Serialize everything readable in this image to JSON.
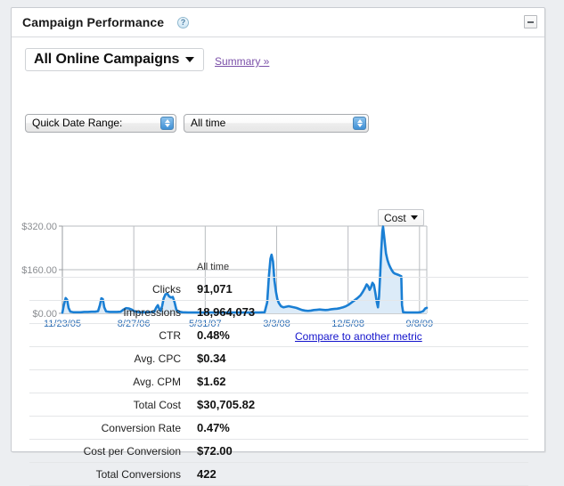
{
  "panel": {
    "title": "Campaign Performance",
    "help_icon": "question-mark-icon",
    "minimize_icon": "minimize-icon"
  },
  "controls": {
    "campaign_selector_label": "All Online Campaigns",
    "summary_link": "Summary »",
    "date_range_label": "Quick Date Range:",
    "time_period_value": "All time"
  },
  "chart_controls": {
    "metric_label": "Cost",
    "compare_link": "Compare to another metric"
  },
  "table": {
    "column_header": "All time",
    "rows": [
      {
        "label": "Clicks",
        "value": "91,071"
      },
      {
        "label": "Impressions",
        "value": "18,964,073"
      },
      {
        "label": "CTR",
        "value": "0.48%"
      },
      {
        "label": "Avg. CPC",
        "value": "$0.34"
      },
      {
        "label": "Avg. CPM",
        "value": "$1.62"
      },
      {
        "label": "Total Cost",
        "value": "$30,705.82"
      },
      {
        "label": "Conversion Rate",
        "value": "0.47%"
      },
      {
        "label": "Cost per Conversion",
        "value": "$72.00"
      },
      {
        "label": "Total Conversions",
        "value": "422"
      }
    ]
  },
  "colors": {
    "line": "#1a7fd4",
    "fill": "#dcebf8",
    "grid": "#b9bcc0",
    "axis_text": "#8a8d91",
    "tick_text": "#2f6fb5",
    "link": "#1414cc",
    "visited_link": "#7a4fa8"
  },
  "chart_data": {
    "type": "area",
    "title": "Cost",
    "xlabel": "",
    "ylabel": "Cost",
    "ylim": [
      0,
      320
    ],
    "yticks": [
      0,
      160,
      320
    ],
    "ytick_labels": [
      "$0.00",
      "$160.00",
      "$320.00"
    ],
    "grid": true,
    "legend": "none",
    "xtick_labels": [
      "11/23/05",
      "8/27/06",
      "5/31/07",
      "3/3/08",
      "12/5/08",
      "9/8/09"
    ],
    "xtick_positions": [
      0.0,
      0.196,
      0.392,
      0.588,
      0.784,
      0.98
    ],
    "x_unit": "date",
    "series": [
      {
        "name": "Cost",
        "points": [
          [
            0.0,
            2
          ],
          [
            0.004,
            30
          ],
          [
            0.009,
            56
          ],
          [
            0.013,
            50
          ],
          [
            0.017,
            20
          ],
          [
            0.022,
            6
          ],
          [
            0.03,
            4
          ],
          [
            0.04,
            4
          ],
          [
            0.05,
            4
          ],
          [
            0.06,
            5
          ],
          [
            0.07,
            5
          ],
          [
            0.08,
            6
          ],
          [
            0.09,
            6
          ],
          [
            0.098,
            8
          ],
          [
            0.103,
            30
          ],
          [
            0.107,
            55
          ],
          [
            0.111,
            52
          ],
          [
            0.115,
            22
          ],
          [
            0.12,
            7
          ],
          [
            0.13,
            5
          ],
          [
            0.14,
            5
          ],
          [
            0.15,
            5
          ],
          [
            0.16,
            6
          ],
          [
            0.168,
            14
          ],
          [
            0.175,
            19
          ],
          [
            0.182,
            18
          ],
          [
            0.19,
            14
          ],
          [
            0.197,
            8
          ],
          [
            0.205,
            5
          ],
          [
            0.215,
            4
          ],
          [
            0.225,
            4
          ],
          [
            0.235,
            4
          ],
          [
            0.245,
            5
          ],
          [
            0.252,
            6
          ],
          [
            0.258,
            22
          ],
          [
            0.262,
            30
          ],
          [
            0.266,
            16
          ],
          [
            0.27,
            9
          ],
          [
            0.274,
            28
          ],
          [
            0.278,
            55
          ],
          [
            0.283,
            70
          ],
          [
            0.288,
            72
          ],
          [
            0.293,
            62
          ],
          [
            0.298,
            58
          ],
          [
            0.303,
            60
          ],
          [
            0.308,
            40
          ],
          [
            0.313,
            12
          ],
          [
            0.32,
            6
          ],
          [
            0.33,
            4
          ],
          [
            0.345,
            3
          ],
          [
            0.36,
            3
          ],
          [
            0.38,
            3
          ],
          [
            0.4,
            3
          ],
          [
            0.42,
            3
          ],
          [
            0.44,
            3
          ],
          [
            0.46,
            3
          ],
          [
            0.48,
            3
          ],
          [
            0.5,
            3
          ],
          [
            0.52,
            3
          ],
          [
            0.54,
            3
          ],
          [
            0.555,
            4
          ],
          [
            0.562,
            40
          ],
          [
            0.567,
            140
          ],
          [
            0.571,
            200
          ],
          [
            0.574,
            215
          ],
          [
            0.578,
            190
          ],
          [
            0.582,
            120
          ],
          [
            0.586,
            80
          ],
          [
            0.59,
            52
          ],
          [
            0.594,
            38
          ],
          [
            0.6,
            26
          ],
          [
            0.607,
            22
          ],
          [
            0.614,
            24
          ],
          [
            0.621,
            26
          ],
          [
            0.628,
            24
          ],
          [
            0.635,
            22
          ],
          [
            0.642,
            20
          ],
          [
            0.65,
            16
          ],
          [
            0.658,
            12
          ],
          [
            0.666,
            10
          ],
          [
            0.674,
            9
          ],
          [
            0.682,
            10
          ],
          [
            0.69,
            12
          ],
          [
            0.698,
            13
          ],
          [
            0.706,
            14
          ],
          [
            0.714,
            13
          ],
          [
            0.722,
            12
          ],
          [
            0.73,
            13
          ],
          [
            0.738,
            15
          ],
          [
            0.746,
            16
          ],
          [
            0.754,
            17
          ],
          [
            0.762,
            19
          ],
          [
            0.77,
            22
          ],
          [
            0.778,
            26
          ],
          [
            0.786,
            32
          ],
          [
            0.794,
            40
          ],
          [
            0.802,
            48
          ],
          [
            0.81,
            56
          ],
          [
            0.818,
            66
          ],
          [
            0.824,
            78
          ],
          [
            0.83,
            92
          ],
          [
            0.835,
            106
          ],
          [
            0.839,
            100
          ],
          [
            0.843,
            86
          ],
          [
            0.847,
            96
          ],
          [
            0.851,
            112
          ],
          [
            0.855,
            104
          ],
          [
            0.859,
            74
          ],
          [
            0.863,
            40
          ],
          [
            0.866,
            22
          ],
          [
            0.869,
            62
          ],
          [
            0.872,
            140
          ],
          [
            0.875,
            230
          ],
          [
            0.878,
            300
          ],
          [
            0.88,
            318
          ],
          [
            0.884,
            270
          ],
          [
            0.888,
            220
          ],
          [
            0.892,
            196
          ],
          [
            0.896,
            180
          ],
          [
            0.9,
            168
          ],
          [
            0.904,
            158
          ],
          [
            0.908,
            150
          ],
          [
            0.912,
            146
          ],
          [
            0.916,
            144
          ],
          [
            0.92,
            142
          ],
          [
            0.924,
            140
          ],
          [
            0.927,
            138
          ],
          [
            0.93,
            136
          ],
          [
            0.932,
            30
          ],
          [
            0.935,
            4
          ],
          [
            0.945,
            3
          ],
          [
            0.955,
            3
          ],
          [
            0.965,
            3
          ],
          [
            0.975,
            3
          ],
          [
            0.982,
            4
          ],
          [
            0.99,
            8
          ],
          [
            0.996,
            18
          ],
          [
            1.0,
            20
          ]
        ]
      }
    ]
  }
}
